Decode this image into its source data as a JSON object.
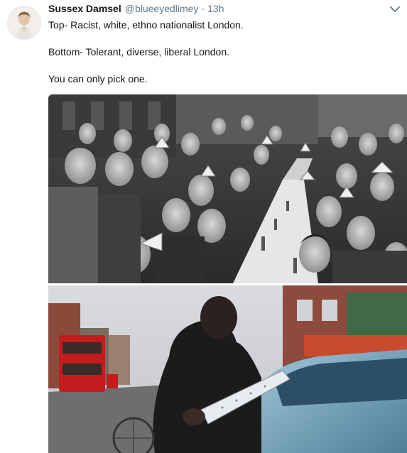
{
  "tweet": {
    "display_name": "Sussex Damsel",
    "handle": "@blueeyedlimey",
    "separator": "·",
    "time": "13h",
    "lines": [
      "Top- Racist, white, ethno nationalist London.",
      "Bottom- Tolerant, diverse, liberal London.",
      "You can only pick one."
    ]
  },
  "icons": {
    "menu": "chevron-down-icon"
  },
  "colors": {
    "text": "#14171a",
    "secondary": "#657786"
  }
}
